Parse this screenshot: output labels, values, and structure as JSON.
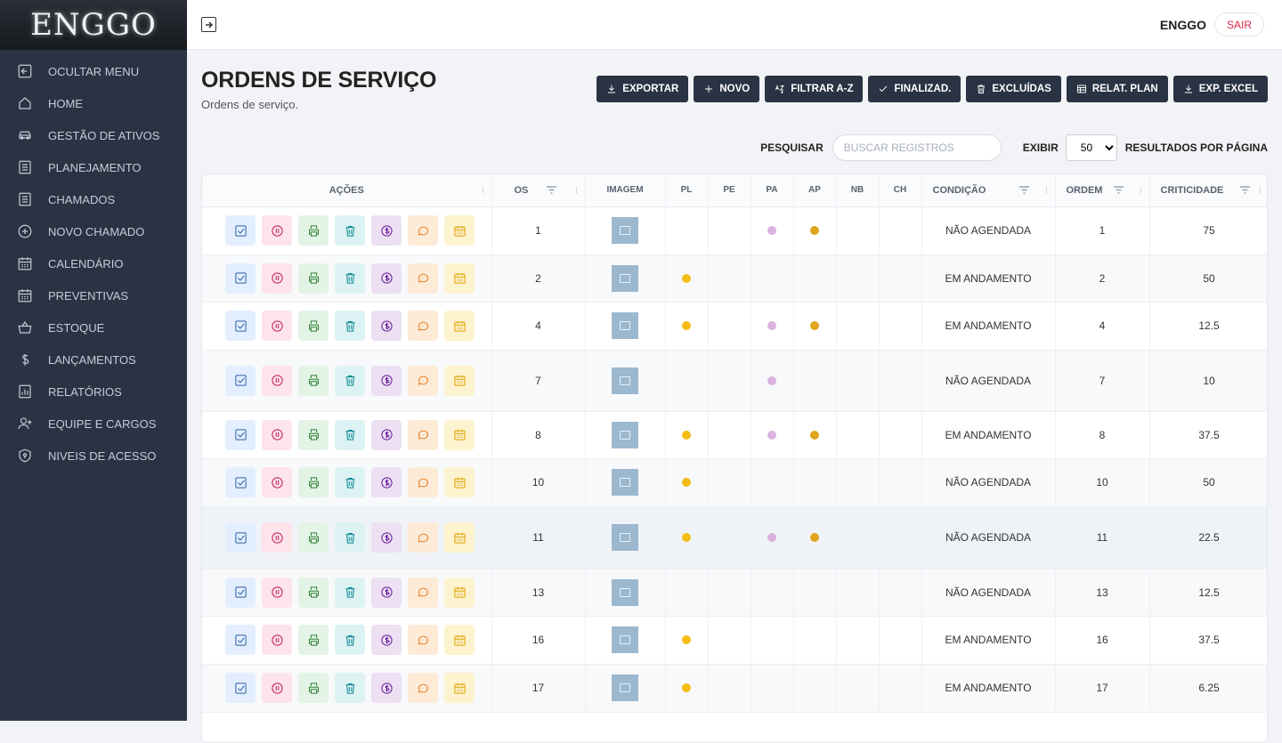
{
  "brand": {
    "logo": "ENGGO"
  },
  "sidebar": {
    "items": [
      {
        "label": "OCULTAR MENU",
        "icon": "collapse-icon"
      },
      {
        "label": "HOME",
        "icon": "home-icon"
      },
      {
        "label": "GESTÃO DE ATIVOS",
        "icon": "car-icon"
      },
      {
        "label": "PLANEJAMENTO",
        "icon": "list-icon"
      },
      {
        "label": "CHAMADOS",
        "icon": "list-icon"
      },
      {
        "label": "NOVO CHAMADO",
        "icon": "plus-circle-icon"
      },
      {
        "label": "CALENDÁRIO",
        "icon": "calendar-icon"
      },
      {
        "label": "PREVENTIVAS",
        "icon": "calendar-icon"
      },
      {
        "label": "ESTOQUE",
        "icon": "basket-icon"
      },
      {
        "label": "LANÇAMENTOS",
        "icon": "dollar-icon"
      },
      {
        "label": "RELATÓRIOS",
        "icon": "report-icon"
      },
      {
        "label": "EQUIPE E CARGOS",
        "icon": "user-plus-icon"
      },
      {
        "label": "NIVEIS DE ACESSO",
        "icon": "shield-icon"
      }
    ]
  },
  "header": {
    "user": "ENGGO",
    "logout": "SAIR"
  },
  "page": {
    "title": "ORDENS DE SERVIÇO",
    "subtitle": "Ordens de serviço."
  },
  "toolbar": [
    {
      "label": "EXPORTAR",
      "icon": "download-icon"
    },
    {
      "label": "NOVO",
      "icon": "plus-icon"
    },
    {
      "label": "FILTRAR A-Z",
      "icon": "sort-az-icon"
    },
    {
      "label": "FINALIZAD.",
      "icon": "check-icon"
    },
    {
      "label": "EXCLUÍDAS",
      "icon": "trash-icon"
    },
    {
      "label": "RELAT. PLAN",
      "icon": "table-icon"
    },
    {
      "label": "EXP. EXCEL",
      "icon": "download-icon"
    }
  ],
  "filters": {
    "search_label": "PESQUISAR",
    "search_placeholder": "BUSCAR REGISTROS",
    "show_label": "EXIBIR",
    "per_page": "50",
    "per_page_suffix": "RESULTADOS POR PÁGINA"
  },
  "table": {
    "columns": {
      "acoes": "AÇÕES",
      "os": "OS",
      "imagem": "IMAGEM",
      "pl": "PL",
      "pe": "PE",
      "pa": "PA",
      "ap": "AP",
      "nb": "NB",
      "ch": "CH",
      "condicao": "CONDIÇÃO",
      "ordem": "ORDEM",
      "criticidade": "CRITICIDADE"
    },
    "action_buttons": [
      {
        "icon": "check-square-icon",
        "bg": "#e3efff",
        "color": "#2b5fa8"
      },
      {
        "icon": "pause-icon",
        "bg": "#fde3ea",
        "color": "#c2185b"
      },
      {
        "icon": "print-icon",
        "bg": "#e3f4e6",
        "color": "#2e7d32"
      },
      {
        "icon": "trash-icon",
        "bg": "#ddf3f3",
        "color": "#00838f"
      },
      {
        "icon": "dollar-circle-icon",
        "bg": "#ede0f3",
        "color": "#6a1b9a"
      },
      {
        "icon": "comment-icon",
        "bg": "#fdebd7",
        "color": "#e67e22"
      },
      {
        "icon": "calendar-icon",
        "bg": "#fdf3cf",
        "color": "#e0a100"
      }
    ],
    "colors": {
      "pl": "#f4bd16",
      "pa": "#dbb1dd",
      "ap": "#e0a41e"
    },
    "rows": [
      {
        "os": "1",
        "pl": false,
        "pa": true,
        "ap": true,
        "condicao": "NÃO AGENDADA",
        "ordem": "1",
        "criticidade": "75"
      },
      {
        "os": "2",
        "pl": true,
        "pa": false,
        "ap": false,
        "condicao": "EM ANDAMENTO",
        "ordem": "2",
        "criticidade": "50"
      },
      {
        "os": "4",
        "pl": true,
        "pa": true,
        "ap": true,
        "condicao": "EM ANDAMENTO",
        "ordem": "4",
        "criticidade": "12.5"
      },
      {
        "os": "7",
        "pl": false,
        "pa": true,
        "ap": false,
        "condicao": "NÃO AGENDADA",
        "ordem": "7",
        "criticidade": "10"
      },
      {
        "os": "8",
        "pl": true,
        "pa": true,
        "ap": true,
        "condicao": "EM ANDAMENTO",
        "ordem": "8",
        "criticidade": "37.5"
      },
      {
        "os": "10",
        "pl": true,
        "pa": false,
        "ap": false,
        "condicao": "NÃO AGENDADA",
        "ordem": "10",
        "criticidade": "50"
      },
      {
        "os": "11",
        "pl": true,
        "pa": true,
        "ap": true,
        "condicao": "NÃO AGENDADA",
        "ordem": "11",
        "criticidade": "22.5"
      },
      {
        "os": "13",
        "pl": false,
        "pa": false,
        "ap": false,
        "condicao": "NÃO AGENDADA",
        "ordem": "13",
        "criticidade": "12.5"
      },
      {
        "os": "16",
        "pl": true,
        "pa": false,
        "ap": false,
        "condicao": "EM ANDAMENTO",
        "ordem": "16",
        "criticidade": "37.5"
      },
      {
        "os": "17",
        "pl": true,
        "pa": false,
        "ap": false,
        "condicao": "EM ANDAMENTO",
        "ordem": "17",
        "criticidade": "6.25"
      }
    ]
  }
}
